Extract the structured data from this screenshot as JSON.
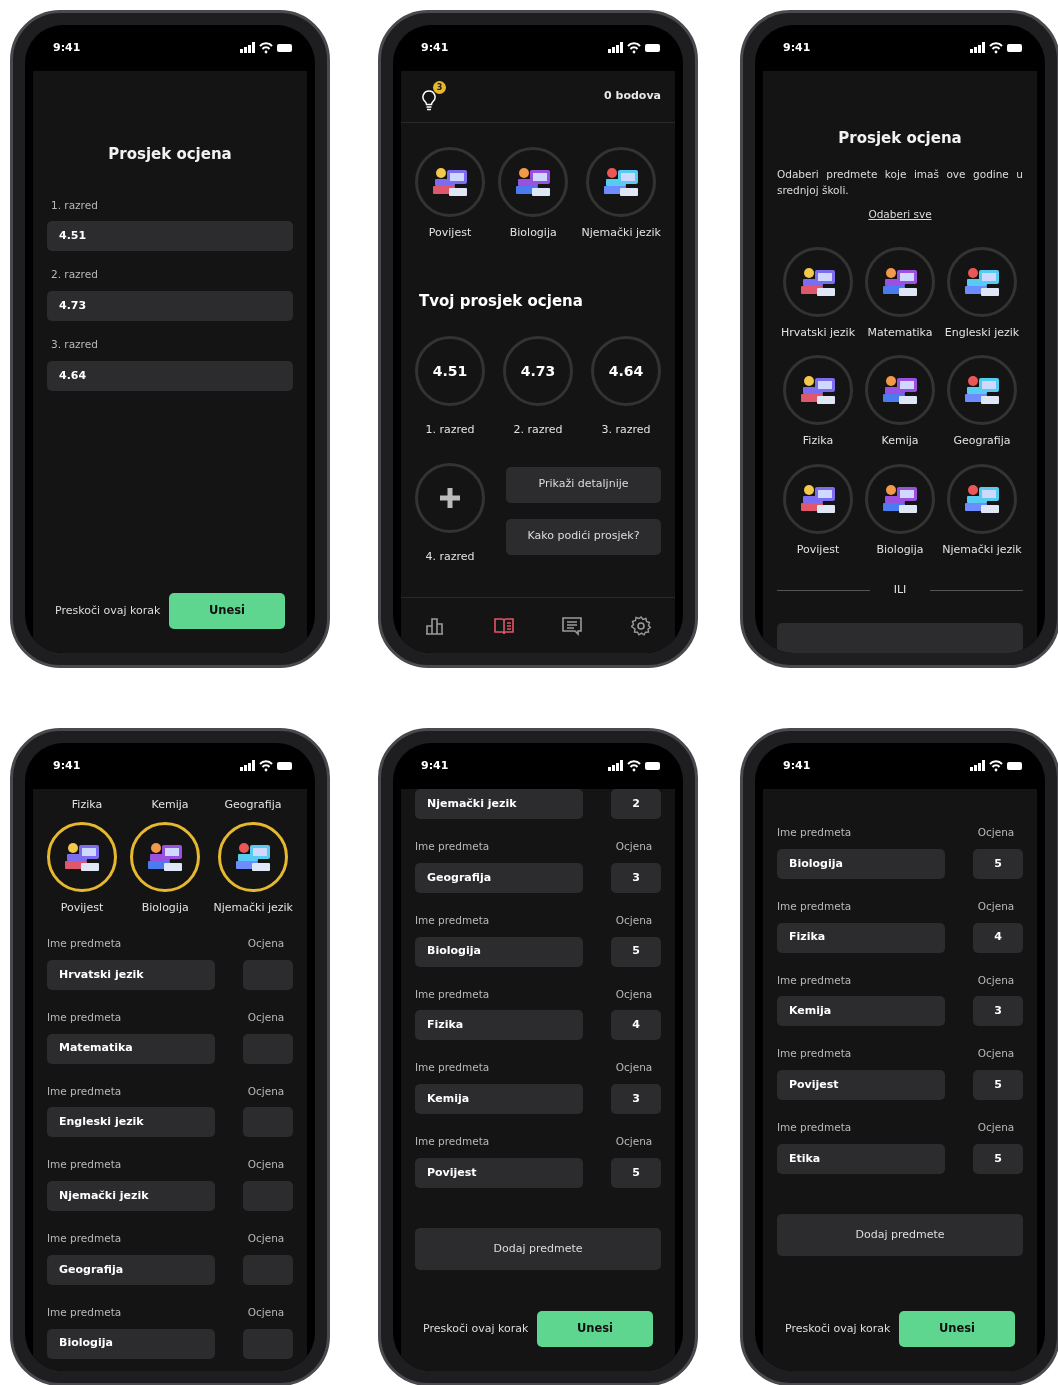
{
  "phones": [
    {
      "kind": "averages_entry",
      "time": "9:41",
      "title": "Prosjek ocjena",
      "fields": [
        {
          "label": "1. razred",
          "value": "4.51"
        },
        {
          "label": "2. razred",
          "value": "4.73"
        },
        {
          "label": "3. razred",
          "value": "4.64"
        }
      ],
      "skip": "Preskoči ovaj korak",
      "submit": "Unesi"
    },
    {
      "kind": "dashboard",
      "time": "9:41",
      "hint_count": "3",
      "points": "0 bodova",
      "subjects": [
        {
          "name": "Povijest",
          "selected": false
        },
        {
          "name": "Biologija",
          "selected": false
        },
        {
          "name": "Njemački jezik",
          "selected": false
        }
      ],
      "section_title": "Tvoj prosjek ocjena",
      "averages": [
        {
          "value": "4.51",
          "label": "1. razred"
        },
        {
          "value": "4.73",
          "label": "2. razred"
        },
        {
          "value": "4.64",
          "label": "3. razred"
        }
      ],
      "add_label": "4. razred",
      "buttons": [
        "Prikaži detaljnije",
        "Kako podići prosjek?"
      ],
      "nav": [
        {
          "selected": false
        },
        {
          "selected": true
        },
        {
          "selected": false
        },
        {
          "selected": false
        }
      ]
    },
    {
      "kind": "subject_picker",
      "time": "9:41",
      "title": "Prosjek ocjena",
      "description": "Odaberi predmete koje imaš ove godine u srednjoj školi.",
      "select_all": "Odaberi sve",
      "subjects": [
        {
          "name": "Hrvatski jezik",
          "selected": false
        },
        {
          "name": "Matematika",
          "selected": false
        },
        {
          "name": "Engleski jezik",
          "selected": false
        },
        {
          "name": "Fizika",
          "selected": false
        },
        {
          "name": "Kemija",
          "selected": false
        },
        {
          "name": "Geografija",
          "selected": false
        },
        {
          "name": "Povijest",
          "selected": false
        },
        {
          "name": "Biologija",
          "selected": false
        },
        {
          "name": "Njemački jezik",
          "selected": false
        }
      ],
      "divider": "ILI"
    },
    {
      "kind": "grade_form",
      "time": "9:41",
      "captions": [
        "Fizika",
        "Kemija",
        "Geografija"
      ],
      "subjects": [
        {
          "name": "Povijest",
          "selected": true
        },
        {
          "name": "Biologija",
          "selected": true
        },
        {
          "name": "Njemački jezik",
          "selected": true
        }
      ],
      "rows": [
        {
          "name_label": "Ime predmeta",
          "grade_label": "Ocjena",
          "name": "Hrvatski jezik"
        },
        {
          "name_label": "Ime predmeta",
          "grade_label": "Ocjena",
          "name": "Matematika"
        },
        {
          "name_label": "Ime predmeta",
          "grade_label": "Ocjena",
          "name": "Engleski jezik"
        },
        {
          "name_label": "Ime predmeta",
          "grade_label": "Ocjena",
          "name": "Njemački jezik"
        },
        {
          "name_label": "Ime predmeta",
          "grade_label": "Ocjena",
          "name": "Geografija"
        },
        {
          "name_label": "Ime predmeta",
          "grade_label": "Ocjena",
          "name": "Biologija"
        }
      ]
    },
    {
      "kind": "grade_form",
      "time": "9:41",
      "rows": [
        {
          "name": "Njemački jezik",
          "grade": "2"
        },
        {
          "name_label": "Ime predmeta",
          "grade_label": "Ocjena",
          "name": "Geografija",
          "grade": "3"
        },
        {
          "name_label": "Ime predmeta",
          "grade_label": "Ocjena",
          "name": "Biologija",
          "grade": "5"
        },
        {
          "name_label": "Ime predmeta",
          "grade_label": "Ocjena",
          "name": "Fizika",
          "grade": "4"
        },
        {
          "name_label": "Ime predmeta",
          "grade_label": "Ocjena",
          "name": "Kemija",
          "grade": "3"
        },
        {
          "name_label": "Ime predmeta",
          "grade_label": "Ocjena",
          "name": "Povijest",
          "grade": "5"
        }
      ],
      "add": "Dodaj predmete",
      "skip": "Preskoči ovaj korak",
      "submit": "Unesi"
    },
    {
      "kind": "grade_form",
      "time": "9:41",
      "rows": [
        {
          "name_label": "Ime predmeta",
          "grade_label": "Ocjena",
          "name": "Biologija",
          "grade": "5"
        },
        {
          "name_label": "Ime predmeta",
          "grade_label": "Ocjena",
          "name": "Fizika",
          "grade": "4"
        },
        {
          "name_label": "Ime predmeta",
          "grade_label": "Ocjena",
          "name": "Kemija",
          "grade": "3"
        },
        {
          "name_label": "Ime predmeta",
          "grade_label": "Ocjena",
          "name": "Povijest",
          "grade": "5"
        },
        {
          "name_label": "Ime predmeta",
          "grade_label": "Ocjena",
          "name": "Etika",
          "grade": "5"
        }
      ],
      "add": "Dodaj predmete",
      "skip": "Preskoči ovaj korak",
      "submit": "Unesi"
    }
  ]
}
